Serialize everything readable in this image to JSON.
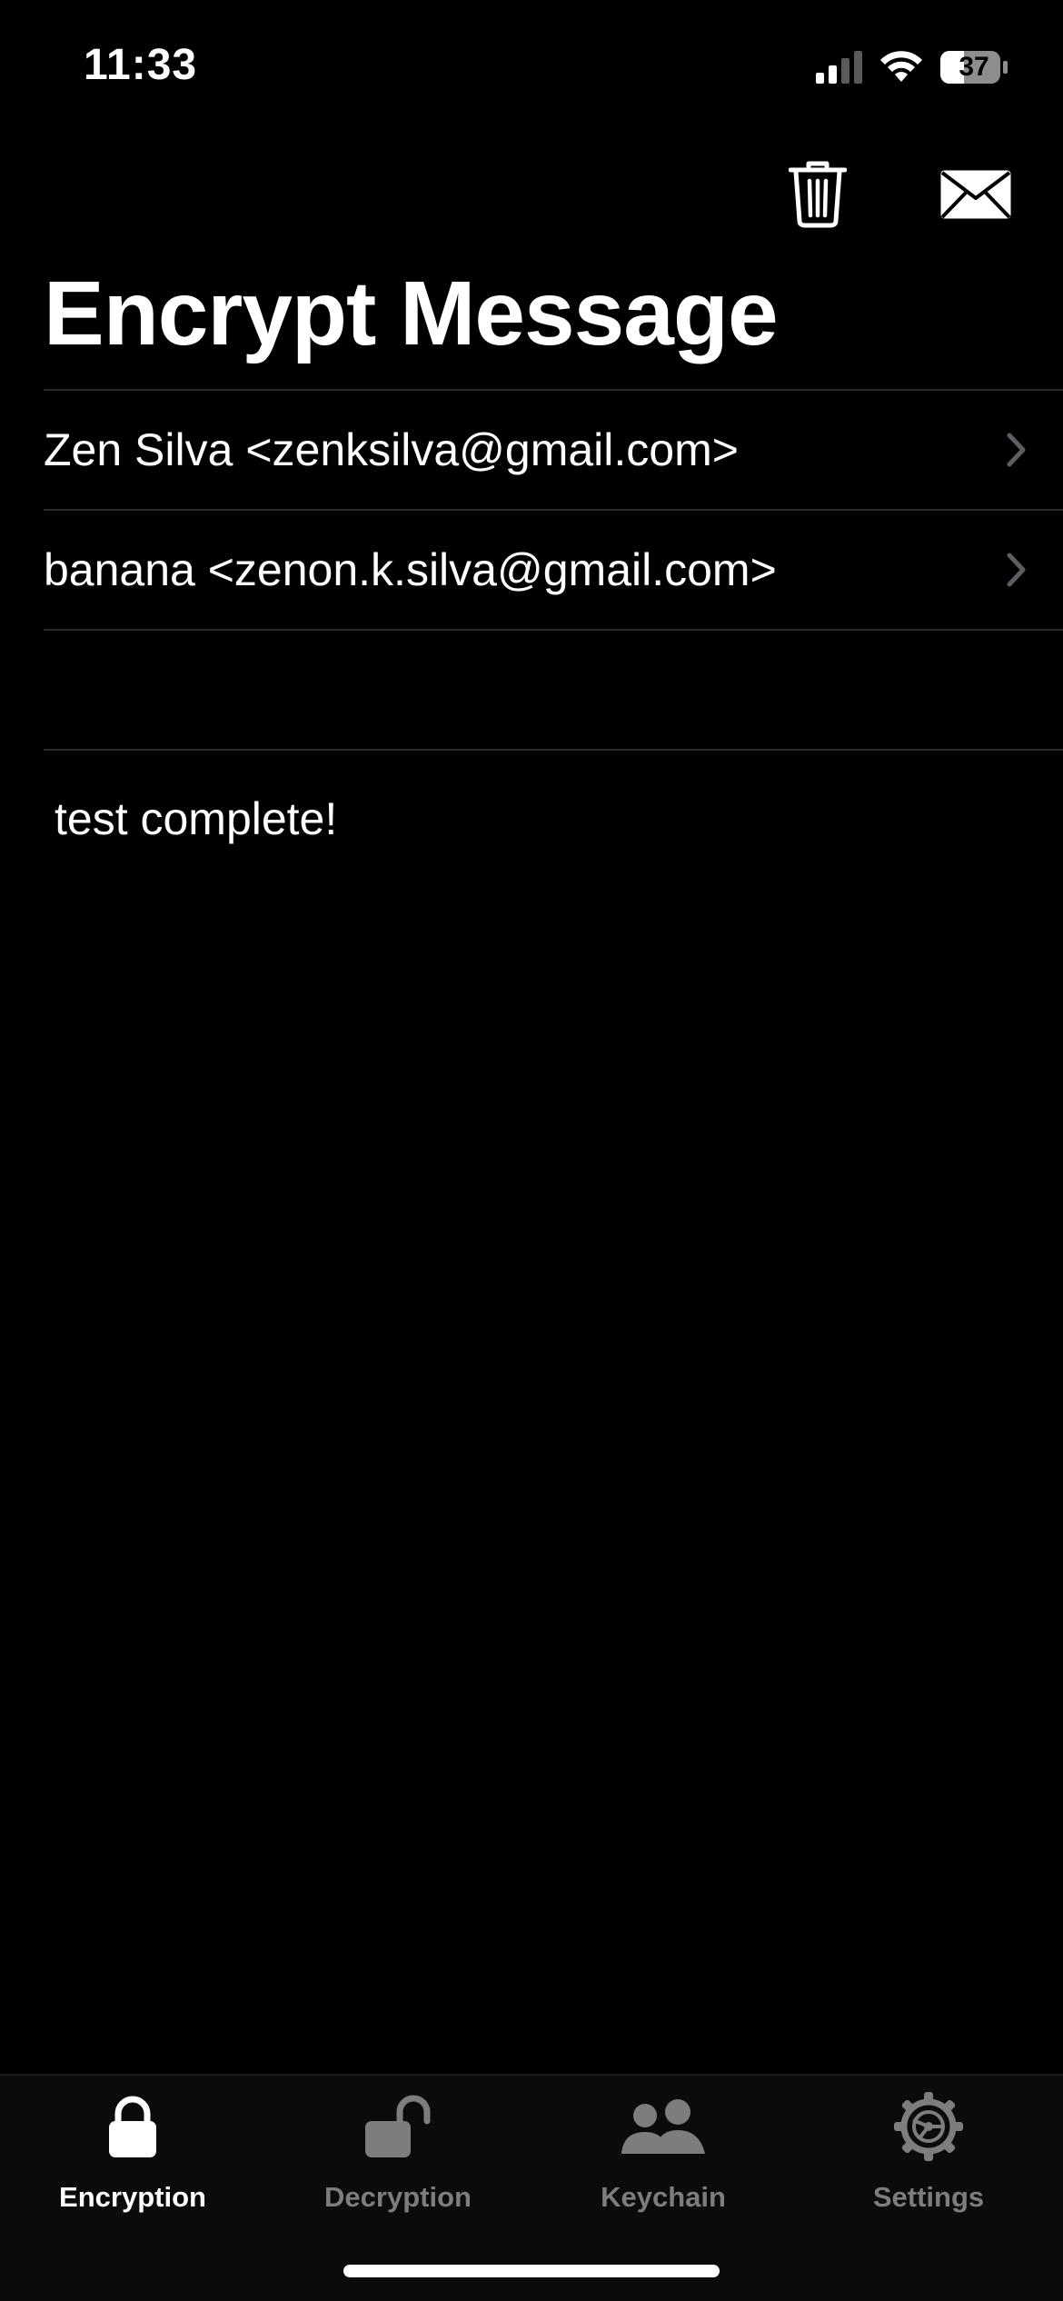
{
  "status_bar": {
    "time": "11:33",
    "battery": "37"
  },
  "toolbar": {
    "delete_icon": "trash-icon",
    "send_icon": "envelope-icon"
  },
  "title": "Encrypt Message",
  "recipients": [
    {
      "label": "Zen Silva <zenksilva@gmail.com>"
    },
    {
      "label": "banana <zenon.k.silva@gmail.com>"
    }
  ],
  "message": "test complete!",
  "tabs": [
    {
      "label": "Encryption",
      "icon": "lock-icon",
      "active": true
    },
    {
      "label": "Decryption",
      "icon": "unlock-icon",
      "active": false
    },
    {
      "label": "Keychain",
      "icon": "people-icon",
      "active": false
    },
    {
      "label": "Settings",
      "icon": "gear-icon",
      "active": false
    }
  ],
  "colors": {
    "background": "#000000",
    "text": "#ffffff",
    "inactive": "#7d7d80",
    "divider": "#2b2b2d"
  }
}
